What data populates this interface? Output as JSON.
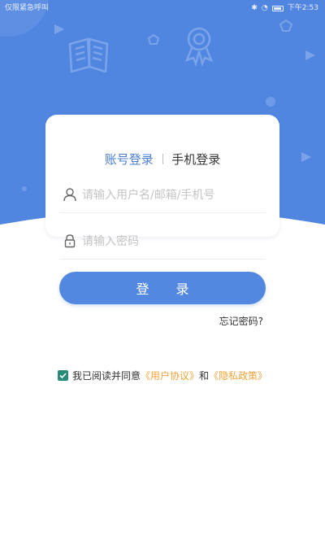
{
  "status_bar": {
    "left_text": "仅限紧急呼叫",
    "time": "下午2:53"
  },
  "login": {
    "tab_account": "账号登录",
    "tab_phone": "手机登录",
    "username_placeholder": "请输入用户名/邮箱/手机号",
    "password_placeholder": "请输入密码",
    "submit_label": "登 录",
    "forgot_label": "忘记密码?"
  },
  "agreement": {
    "checked": true,
    "prefix": "我已阅读并同意",
    "user_agreement": "《用户协议》",
    "and_text": "和",
    "privacy_policy": "《隐私政策》"
  },
  "icons": {
    "user": "user-icon",
    "lock": "lock-icon",
    "checkbox": "checkmark-icon",
    "decor": [
      "book-icon",
      "award-icon",
      "play-icon",
      "pentagon-icon"
    ]
  },
  "colors": {
    "hero_blue": "#5186e0",
    "accent_blue": "#4c7fd4",
    "button_blue": "#5388e0",
    "link_orange": "#f2a33a",
    "checkbox_teal": "#2a8a7a"
  }
}
